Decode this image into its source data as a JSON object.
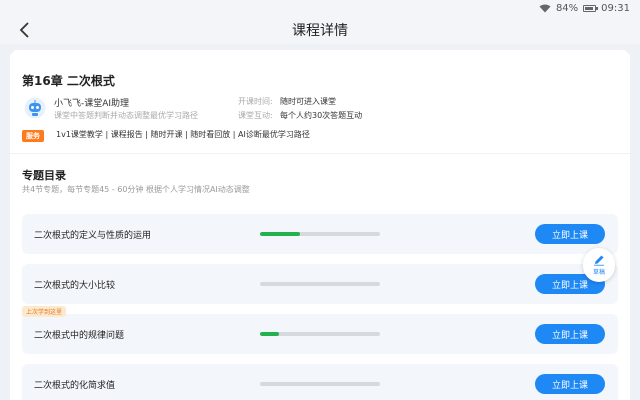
{
  "status_bar": {
    "battery": "84%",
    "time": "09:31"
  },
  "nav": {
    "title": "课程详情",
    "back_icon": "chevron-left-icon"
  },
  "chapter": {
    "title": "第16章 二次根式",
    "assistant_name": "小飞飞-课堂AI助理",
    "assistant_desc": "课堂中答题判断并动态调整最优学习路径",
    "start_time_label": "开课时间:",
    "start_time_value": "随时可进入课堂",
    "interaction_label": "课堂互动:",
    "interaction_value": "每个人约30次答题互动",
    "service_badge": "服务",
    "service_text": "1v1课堂教学 | 课程报告 | 随时开课 | 随时看回放 | AI诊断最优学习路径"
  },
  "section": {
    "title": "专题目录",
    "subtitle": "共4节专题，每节专题45 - 60分钟 根据个人学习情况AI动态调整"
  },
  "topics": [
    {
      "name": "二次根式的定义与性质的运用",
      "progress": 0.33,
      "button": "立即上课",
      "badge": ""
    },
    {
      "name": "二次根式的大小比较",
      "progress": 0.0,
      "button": "立即上课",
      "badge": ""
    },
    {
      "name": "二次根式中的规律问题",
      "progress": 0.16,
      "button": "立即上课",
      "badge": "上次学到这里"
    },
    {
      "name": "二次根式的化简求值",
      "progress": 0.0,
      "button": "立即上课",
      "badge": ""
    }
  ],
  "draft": {
    "label": "草稿",
    "icon": "pencil-icon"
  },
  "colors": {
    "accent": "#1e88f5",
    "progress": "#22b14c",
    "badge_orange": "#ff7a1a"
  }
}
